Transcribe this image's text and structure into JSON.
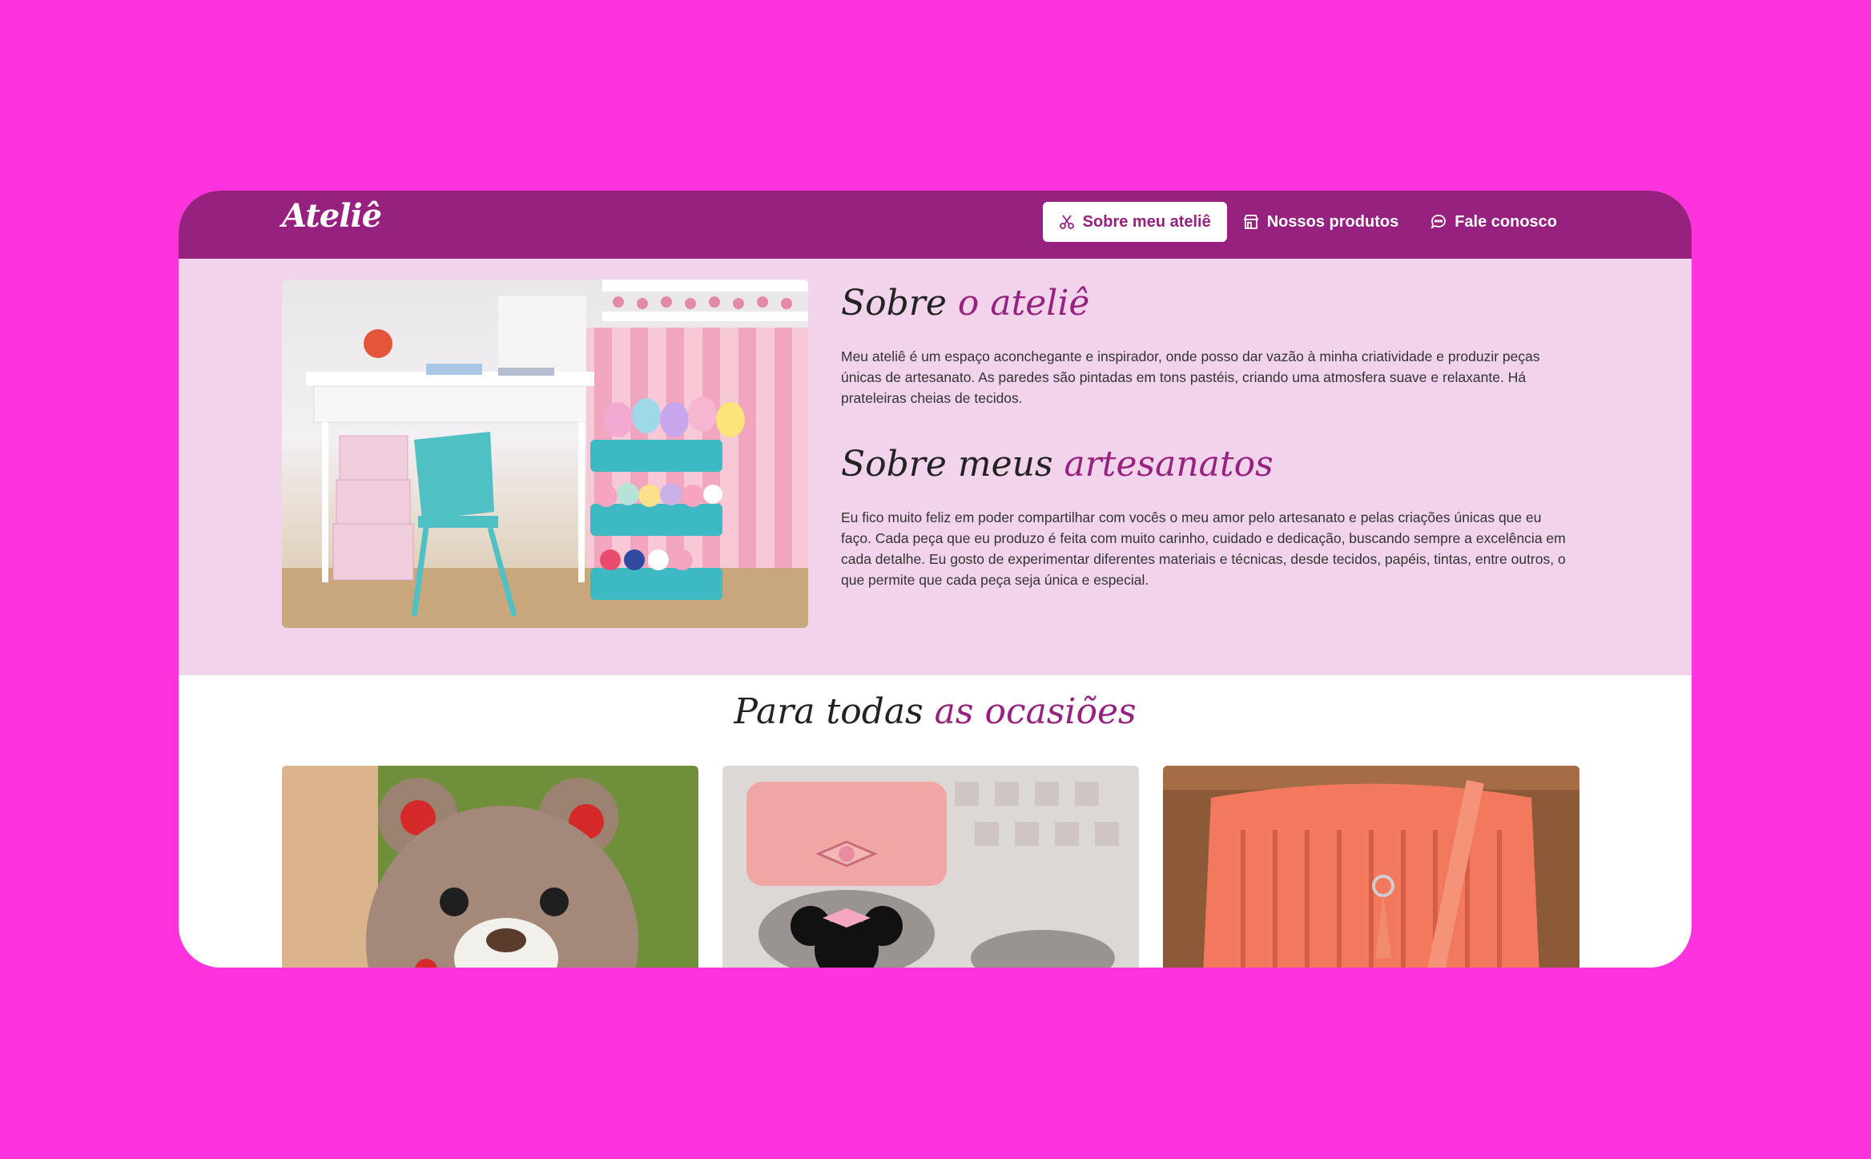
{
  "brand": "Ateliê",
  "nav": [
    {
      "label": "Sobre meu ateliê",
      "icon": "scissors-icon",
      "active": true
    },
    {
      "label": "Nossos produtos",
      "icon": "store-icon",
      "active": false
    },
    {
      "label": "Fale conosco",
      "icon": "chat-bubble-icon",
      "active": false
    }
  ],
  "about": {
    "heading1_plain": "Sobre ",
    "heading1_accent": "o ateliê",
    "paragraph1": "Meu ateliê é um espaço aconchegante e inspirador, onde posso dar vazão à minha criatividade e produzir peças únicas de artesanato. As paredes são pintadas em tons pastéis, criando uma atmosfera suave e relaxante. Há prateleiras cheias de tecidos.",
    "heading2_plain": "Sobre meus ",
    "heading2_accent": "artesanatos",
    "paragraph2": "Eu fico muito feliz em poder compartilhar com vocês o meu amor pelo artesanato e pelas criações únicas que eu faço. Cada peça que eu produzo é feita com muito carinho, cuidado e dedicação, buscando sempre a excelência em cada detalhe. Eu gosto de experimentar diferentes materiais e técnicas, desde tecidos, papéis, tintas, entre outros, o que permite que cada peça seja única e especial."
  },
  "occasions": {
    "title_plain": "Para todas ",
    "title_accent": "as ocasiões"
  },
  "colors": {
    "page_bg": "#ff33dd",
    "navbar": "#96217f",
    "about_bg": "#f2d3ec",
    "accent": "#96217f"
  }
}
